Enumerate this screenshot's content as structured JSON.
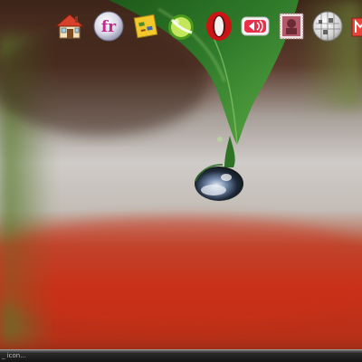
{
  "desktop": {
    "dock": {
      "items": [
        {
          "icon": "home-icon"
        },
        {
          "icon": "fr-logo-icon",
          "label": "fr"
        },
        {
          "icon": "sticky-note-icon"
        },
        {
          "icon": "lime-icon"
        },
        {
          "icon": "opera-icon"
        },
        {
          "icon": "speaker-app-icon"
        },
        {
          "icon": "stamp-icon"
        },
        {
          "icon": "wikipedia-globe-icon"
        },
        {
          "icon": "partial-app-icon"
        }
      ]
    },
    "taskbar": {
      "item_label": "_ icon..."
    },
    "colors": {
      "leaf": "#2f7a2a",
      "wallpaper_top": "#4a2e22",
      "wallpaper_middle": "#c8c4c0",
      "wallpaper_bottom": "#c0321e",
      "taskbar": "#1a1a1a"
    }
  }
}
